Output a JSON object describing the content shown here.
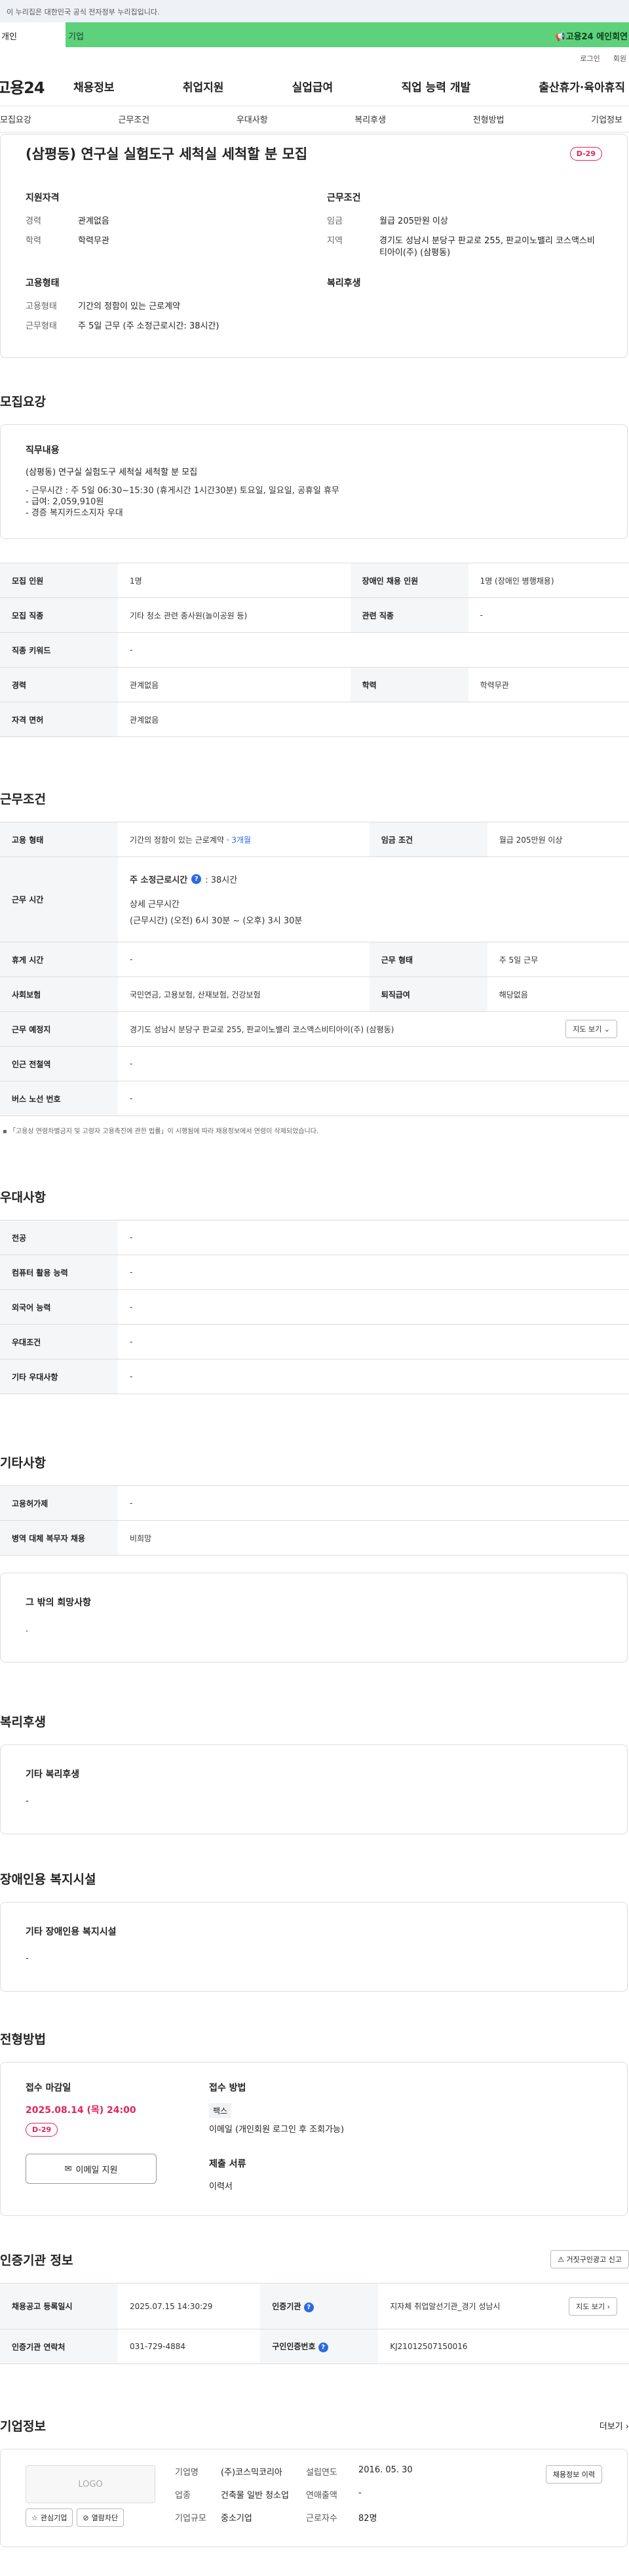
{
  "topbar": {
    "notice": "이 누리집은 대한민국 공식 전자정부 누리집입니다."
  },
  "tabs": {
    "person": "개인",
    "corp": "기업",
    "banner": "고용24 에인회연"
  },
  "util": {
    "login": "로그인",
    "join": "회원"
  },
  "gnb": {
    "logo": "고용24",
    "menu": [
      "채용정보",
      "취업지원",
      "실업급여",
      "직업 능력 개발",
      "출산휴가·육아휴직"
    ]
  },
  "subnav": [
    "모집요강",
    "근무조건",
    "우대사항",
    "복리후생",
    "전형방법",
    "기업정보"
  ],
  "summary": {
    "title": "(삼평동) 연구실 실험도구 세척실 세척할 분 모집",
    "dday": "D-29",
    "qual_title": "지원자격",
    "qual": [
      {
        "k": "경력",
        "v": "관계없음"
      },
      {
        "k": "학력",
        "v": "학력무관"
      }
    ],
    "cond_title": "근무조건",
    "cond": [
      {
        "k": "임금",
        "v": "월급 205만원 이상"
      },
      {
        "k": "지역",
        "v": "경기도 성남시 분당구 판교로 255, 판교이노밸리 코스액스비티아이(주) (삼평동)"
      }
    ],
    "emp_title": "고용형태",
    "emp": [
      {
        "k": "고용형태",
        "v": "기간의 정함이 있는 근로계약"
      },
      {
        "k": "근무형태",
        "v": "주 5일 근무 (주 소정근로시간: 38시간)"
      }
    ],
    "welfare_title": "복리후생"
  },
  "recruit": {
    "section": "모집요강",
    "duty_title": "직무내용",
    "duty_line": "(삼평동) 연구실 실험도구 세척실 세척할 분 모집",
    "duty_detail": "- 근무시간 : 주 5일 06:30~15:30 (휴게시간 1시간30분) 토요일, 일요일, 공휴일 휴무\n- 급여: 2,059,910원\n- 경증 복지카드소지자 우대",
    "rows": [
      {
        "k1": "모집 인원",
        "v1": "1명",
        "k2": "장애인 채용 인원",
        "v2": "1명 (장애인 병행채용)"
      },
      {
        "k1": "모집 직종",
        "v1": "기타 청소 관련 종사원(놀이공원 등)",
        "k2": "관련 직종",
        "v2": "-"
      },
      {
        "k1": "직종 키워드",
        "v1": "-"
      },
      {
        "k1": "경력",
        "v1": "관계없음",
        "k2": "학력",
        "v2": "학력무관"
      },
      {
        "k1": "자격 면허",
        "v1": "관계없음"
      }
    ]
  },
  "work": {
    "section": "근무조건",
    "emp_k": "고용 형태",
    "emp_v": "기간의 정함이 있는 근로계약 · ",
    "emp_v2": "3개월",
    "wage_k": "임금 조건",
    "wage_v": "월급 205만원 이상",
    "time_k": "근무 시간",
    "weekly_label": "주 소정근로시간",
    "weekly_v": ": 38시간",
    "detail_label": "상세 근무시간",
    "detail_v": "(근무시간) (오전) 6시 30분 ~ (오후) 3시 30분",
    "rest_k": "휴게 시간",
    "rest_v": "-",
    "form_k": "근무 형태",
    "form_v": "주 5일 근무",
    "ins_k": "사회보험",
    "ins_v": "국민연금, 고용보험, 산재보험, 건강보험",
    "ret_k": "퇴직급여",
    "ret_v": "해당없음",
    "place_k": "근무 예정지",
    "place_v": "경기도 성남시 분당구 판교로 255, 판교이노밸리 코스액스비티아이(주) (삼평동)",
    "map_btn": "지도 보기",
    "station_k": "인근 전철역",
    "station_v": "-",
    "bus_k": "버스 노선 번호",
    "bus_v": "-",
    "note": "「고용상 연령차별금지 및 고령자 고용촉진에 관한 법률」이 시행됨에 따라 채용정보에서 연령이 삭제되었습니다."
  },
  "pref": {
    "section": "우대사항",
    "rows": [
      {
        "k": "전공",
        "v": "-"
      },
      {
        "k": "컴퓨터 활용 능력",
        "v": "-"
      },
      {
        "k": "외국어 능력",
        "v": "-"
      },
      {
        "k": "우대조건",
        "v": "-"
      },
      {
        "k": "기타 우대사항",
        "v": "-"
      }
    ]
  },
  "etc": {
    "section": "기타사항",
    "rows": [
      {
        "k": "고용허가제",
        "v": "-"
      },
      {
        "k": "병역 대체 복무자 채용",
        "v": "비희망"
      }
    ],
    "hope_title": "그 밖의 희망사항",
    "hope_v": "."
  },
  "welfare": {
    "section": "복리후생",
    "box_title": "기타 복리후생",
    "box_v": "-"
  },
  "disab": {
    "section": "장애인용 복지시설",
    "box_title": "기타 장애인용 복지시설",
    "box_v": "-"
  },
  "screening": {
    "section": "전형방법",
    "deadline_title": "접수 마감일",
    "deadline": "2025.08.14 (목) 24:00",
    "dday": "D-29",
    "apply_btn": "이메일 지원",
    "method_title": "접수 방법",
    "method_tag": "팩스",
    "method_v": "이메일 (개인회원 로그인 후 조회가능)",
    "docs_title": "제출 서류",
    "docs_v": "이력서"
  },
  "cert": {
    "section": "인증기관 정보",
    "report_btn": "거짓구인광고 신고",
    "rows": [
      {
        "k1": "채용공고 등록일시",
        "v1": "2025.07.15 14:30:29",
        "k2": "인증기관",
        "v2": "지자체 취업알선기관_경기 성남시",
        "btn": "지도 보기"
      },
      {
        "k1": "인증기관 연락처",
        "v1": "031-729-4884",
        "k2": "구인인증번호",
        "v2": "KJ21012507150016"
      }
    ]
  },
  "corp": {
    "section": "기업정보",
    "more": "더보기",
    "logo": "LOGO",
    "fav_btn": "관심기업",
    "block_btn": "열람차단",
    "name_k": "기업명",
    "name_v": "(주)코스믹코리아",
    "est_k": "설립연도",
    "est_v": "2016. 05. 30",
    "ind_k": "업종",
    "ind_v": "건축물 일반 청소업",
    "sales_k": "연매출액",
    "sales_v": "-",
    "size_k": "기업규모",
    "size_v": "중소기업",
    "emp_k": "근로자수",
    "emp_v": "82명",
    "jobs_btn": "채용정보 이력"
  }
}
